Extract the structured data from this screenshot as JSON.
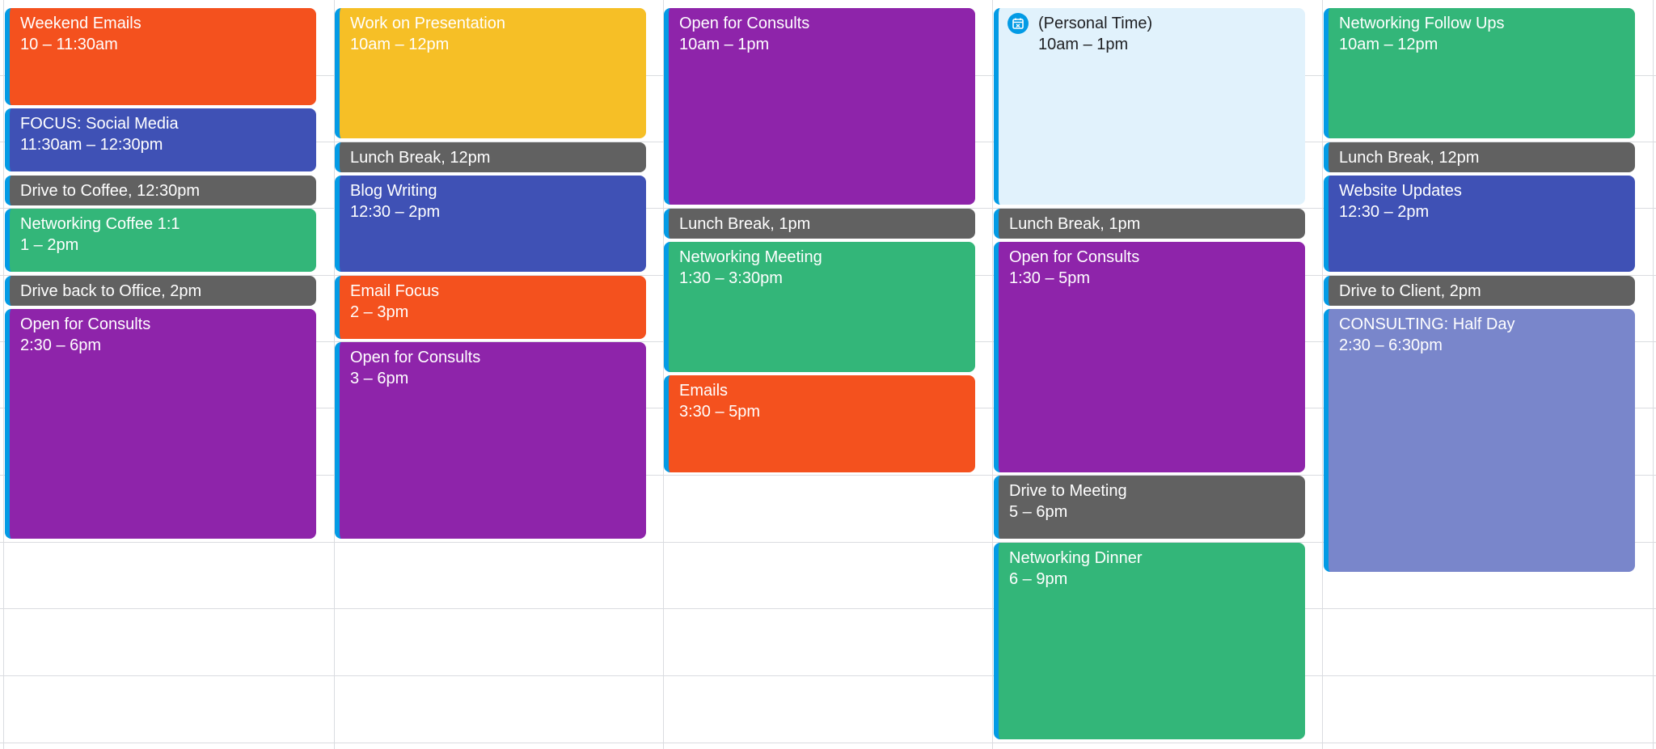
{
  "colors": {
    "tomato": "#f4511e",
    "blueberry": "#3f51b5",
    "graphite": "#616161",
    "basil": "#33b679",
    "grape": "#8e24aa",
    "banana": "#f6bf26",
    "lavender": "#7986cb",
    "light_blue": "#e1f2fc",
    "accent": "#039be5"
  },
  "columns": [
    {
      "events": [
        {
          "title": "Weekend Emails",
          "time": "10 – 11:30am",
          "color": "tomato"
        },
        {
          "title": "FOCUS: Social Media",
          "time": "11:30am – 12:30pm",
          "color": "blueberry"
        },
        {
          "title": "Drive to Coffee,",
          "time": "12:30pm",
          "color": "graphite"
        },
        {
          "title": "Networking Coffee 1:1",
          "time": "1 – 2pm",
          "color": "basil"
        },
        {
          "title": "Drive back to Office,",
          "time": "2pm",
          "color": "graphite"
        },
        {
          "title": "Open for Consults",
          "time": "2:30 – 6pm",
          "color": "grape"
        }
      ]
    },
    {
      "events": [
        {
          "title": "Work on Presentation",
          "time": "10am – 12pm",
          "color": "banana"
        },
        {
          "title": "Lunch Break,",
          "time": "12pm",
          "color": "graphite"
        },
        {
          "title": "Blog Writing",
          "time": "12:30 – 2pm",
          "color": "blueberry"
        },
        {
          "title": "Email Focus",
          "time": "2 – 3pm",
          "color": "tomato"
        },
        {
          "title": "Open for Consults",
          "time": "3 – 6pm",
          "color": "grape"
        }
      ]
    },
    {
      "events": [
        {
          "title": "Open for Consults",
          "time": "10am – 1pm",
          "color": "grape"
        },
        {
          "title": "Lunch Break,",
          "time": "1pm",
          "color": "graphite"
        },
        {
          "title": "Networking Meeting",
          "time": "1:30 – 3:30pm",
          "color": "basil"
        },
        {
          "title": "Emails",
          "time": "3:30 – 5pm",
          "color": "tomato"
        }
      ]
    },
    {
      "events": [
        {
          "title": "(Personal Time)",
          "time": "10am – 1pm",
          "color": "light_blue",
          "icon": "calendar-icon"
        },
        {
          "title": "Lunch Break,",
          "time": "1pm",
          "color": "graphite"
        },
        {
          "title": "Open for Consults",
          "time": "1:30 – 5pm",
          "color": "grape"
        },
        {
          "title": "Drive to Meeting",
          "time": "5 – 6pm",
          "color": "graphite"
        },
        {
          "title": "Networking Dinner",
          "time": "6 – 9pm",
          "color": "basil"
        }
      ]
    },
    {
      "events": [
        {
          "title": "Networking Follow Ups",
          "time": "10am – 12pm",
          "color": "basil"
        },
        {
          "title": "Lunch Break,",
          "time": "12pm",
          "color": "graphite"
        },
        {
          "title": "Website Updates",
          "time": "12:30 – 2pm",
          "color": "blueberry"
        },
        {
          "title": "Drive to Client,",
          "time": "2pm",
          "color": "graphite"
        },
        {
          "title": "CONSULTING: Half Day",
          "time": "2:30 – 6:30pm",
          "color": "lavender"
        }
      ]
    }
  ]
}
